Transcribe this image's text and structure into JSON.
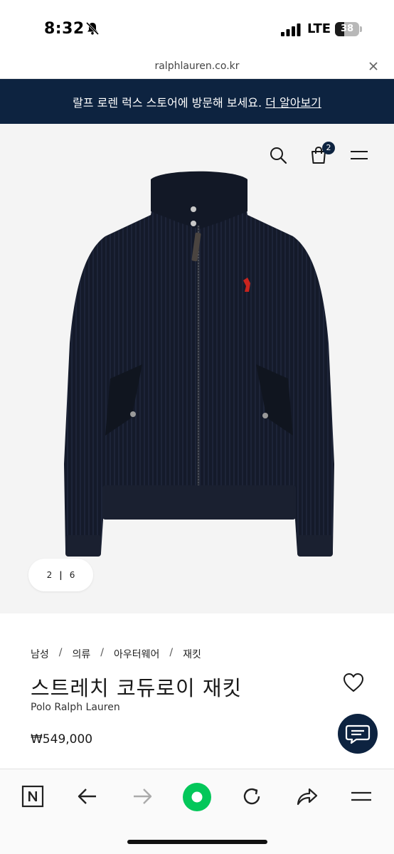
{
  "status_bar": {
    "time": "8:32",
    "carrier": "LTE",
    "battery_level": "38",
    "battery_fraction": 0.38
  },
  "browser": {
    "url": "ralphlauren.co.kr",
    "close_icon": "close-icon"
  },
  "banner": {
    "text": "랄프 로렌 럭스 스토어에 방문해 보세요.",
    "link": "더 알아보기",
    "background": "#0d2340"
  },
  "header": {
    "cart_count": "2",
    "icons": [
      "search-icon",
      "shopping-bag-icon",
      "menu-icon"
    ]
  },
  "gallery": {
    "current": "2",
    "total": "6"
  },
  "product": {
    "breadcrumb": [
      "남성",
      "의류",
      "아우터웨어",
      "재킷"
    ],
    "breadcrumb_separator": "/",
    "title": "스트레치 코듀로이 재킷",
    "brand": "Polo Ralph Lauren",
    "price": "₩549,000"
  },
  "toolbar": {
    "icons": [
      "naver-home-icon",
      "back-arrow-icon",
      "forward-arrow-icon",
      "green-dot-icon",
      "reload-icon",
      "share-icon",
      "menu-icon"
    ],
    "accent": "#03c75a"
  }
}
